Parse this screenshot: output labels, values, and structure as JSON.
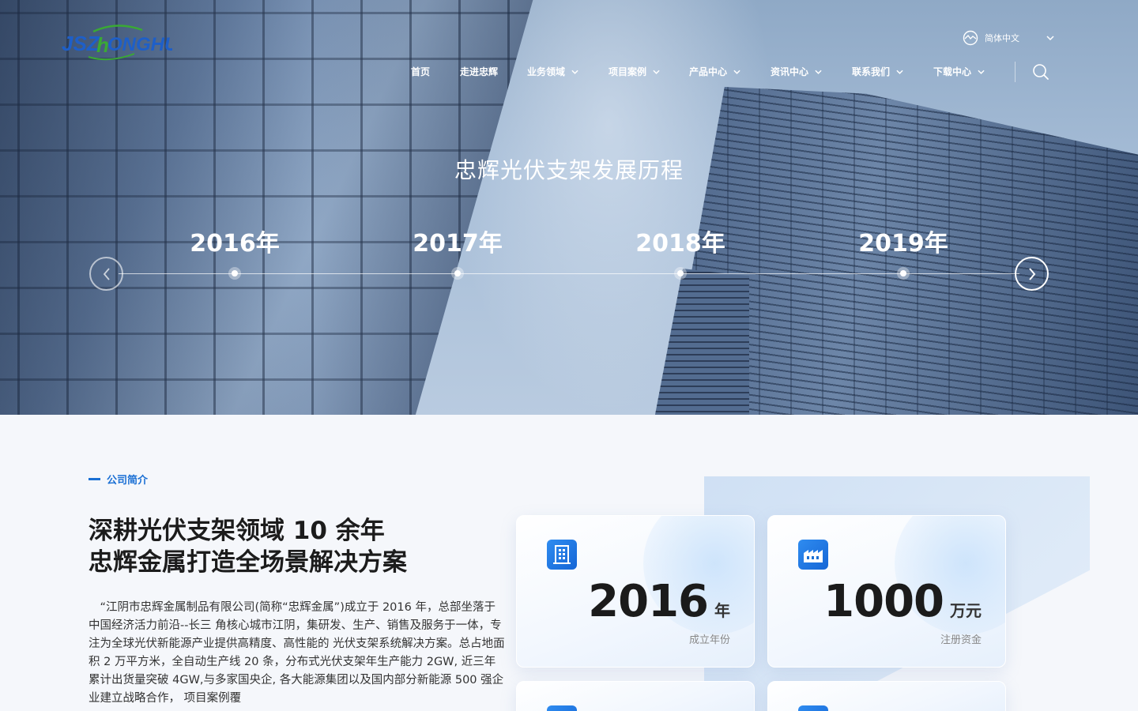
{
  "header": {
    "logo_alt": "JSZ HONGHUI",
    "language": "简体中文",
    "nav": [
      {
        "label": "首页",
        "dropdown": false
      },
      {
        "label": "走进忠辉",
        "dropdown": false
      },
      {
        "label": "业务领域",
        "dropdown": true
      },
      {
        "label": "项目案例",
        "dropdown": true
      },
      {
        "label": "产品中心",
        "dropdown": true
      },
      {
        "label": "资讯中心",
        "dropdown": true
      },
      {
        "label": "联系我们",
        "dropdown": true
      },
      {
        "label": "下载中心",
        "dropdown": true
      }
    ]
  },
  "hero": {
    "title": "忠辉光伏支架发展历程",
    "years": [
      "2016年",
      "2017年",
      "2018年",
      "2019年"
    ]
  },
  "about": {
    "kicker": "公司简介",
    "headline_line1": "深耕光伏支架领域 10 余年",
    "headline_line2": "忠辉金属打造全场景解决方案",
    "description": "“江阴市忠辉金属制品有限公司(简称“忠辉金属”)成立于 2016 年，总部坐落于中国经济活力前沿--长三 角核心城市江阴，集研发、生产、销售及服务于一体，专注为全球光伏新能源产业提供高精度、高性能的 光伏支架系统解决方案。总占地面积 2 万平方米，全自动生产线 20 条，分布式光伏支架年生产能力 2GW, 近三年累计出货量突破 4GW,与多家国央企, 各大能源集团以及国内部分新能源 500 强企业建立战略合作， 项目案例覆",
    "stats": [
      {
        "value": "2016",
        "unit": "年",
        "label": "成立年份",
        "icon": "building-icon"
      },
      {
        "value": "1000",
        "unit": "万元",
        "label": "注册资金",
        "icon": "factory-icon"
      }
    ]
  },
  "colors": {
    "accent": "#1a6fd4",
    "logo_blue": "#1e5fc8",
    "logo_green": "#3aa935"
  }
}
